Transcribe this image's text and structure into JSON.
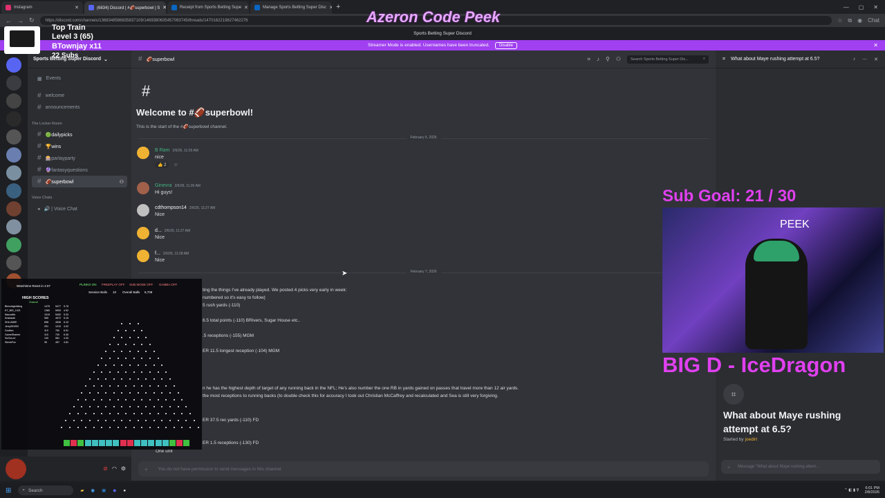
{
  "browser": {
    "tabs": [
      {
        "label": "Instagram",
        "color": "#e1306c",
        "active": false
      },
      {
        "label": "(6834) Discord | #🏈superbowl | S",
        "color": "#5865f2",
        "active": true
      },
      {
        "label": "Receipt from Sports Betting Supe",
        "color": "#0a66c2",
        "active": false
      },
      {
        "label": "Manage Sports Betting Super Disc",
        "color": "#0a66c2",
        "active": false
      }
    ],
    "url": "https://discord.com/channels/1368348586835837109/1469380635457093745/threads/1470162219827462276",
    "new_tab": "+",
    "chat_label": "Chat"
  },
  "overlay": {
    "brand": "Azeron Code Peek",
    "twitch_line1": "Top Train",
    "twitch_line2": "Level 3  (65)",
    "twitch_line3": "BTownjay x11",
    "twitch_line4": "22 Subs",
    "sub_goal": "Sub Goal:  21 / 30",
    "cam_label": "PEEK",
    "big_d": "BIG D -  IceDragon"
  },
  "discord": {
    "top_title": "Sports Betting Super Discord",
    "streamer_msg": "Streamer Mode is enabled. Usernames have been truncated.",
    "streamer_disable": "Disable",
    "server_name": "Sports Betting Super Discord",
    "events": "Events",
    "channels_top": [
      "welcome",
      "announcements"
    ],
    "cat_locker": "The Locker Room",
    "locker_channels": [
      {
        "label": "🟢dailypicks",
        "bold": true
      },
      {
        "label": "🏆wins",
        "bold": true
      },
      {
        "label": "🎰parlayparty",
        "bold": false
      },
      {
        "label": "🔮fantasyquestions",
        "bold": false
      },
      {
        "label": "🏈superbowl",
        "selected": true
      }
    ],
    "cat_voice": "Voice Chats",
    "voice_channel": "🔊 | Voice Chat",
    "channel_header": "🏈superbowl",
    "search_placeholder": "Search Sports Betting Super Dis...",
    "welcome_title": "Welcome to #🏈superbowl!",
    "welcome_sub": "This is the start of the #🏈superbowl channel.",
    "date1": "February 6, 2026",
    "date2": "February 7, 2026",
    "messages": [
      {
        "user": "B Ram",
        "time": "2/6/26, 11:26 AM",
        "text": "nice",
        "color": "#43b581",
        "avatar": "#f0b232",
        "reaction": "👍 2"
      },
      {
        "user": "Ginevra",
        "time": "2/6/26, 11:26 AM",
        "text": "Hi guys!",
        "color": "#43b581",
        "avatar": "#a0604a"
      },
      {
        "user": "cdthompson14",
        "time": "2/6/26, 11:27 AM",
        "text": "Nice",
        "color": "#f2f3f5",
        "avatar": "#c0c0c0"
      },
      {
        "user": "d...",
        "time": "2/6/26, 11:27 AM",
        "text": "Nice",
        "color": "#f2f3f5",
        "avatar": "#f0b232"
      },
      {
        "user": "f...",
        "time": "2/6/26, 11:28 AM",
        "text": "Nice",
        "color": "#f2f3f5",
        "avatar": "#f0b232"
      }
    ],
    "post_lines": [
      "ting the things I've already played. We posted 4 picks very early in week:",
      " numbered so it's easy to follow)",
      "5 rush yards (-110)",
      "6.5 total points (-110) BRivers, Sugar House etc..",
      ".5 receptions (-155) MGM",
      "ER 11.5 longest reception (-104) MGM",
      "n he has the highest depth of target of any running back in the NFL; He's also number the one RB in yards gained on passes that travel more than 12 air yards.",
      "the most receptions to running backs (to double check this for accuracy I took out Christian McCaffrey and recalculated and Sea is still very forgiving.",
      "ER 37.5 rec yards (-110) FD",
      "ER 1.5 receptions (-130) FD",
      "One unit"
    ],
    "composer_placeholder": "You do not have permission to send messages in this channel.",
    "thread_header": "What about Maye rushing attempt at 6.5?",
    "thread_title": "What about Maye rushing attempt at 6.5?",
    "started_by_prefix": "Started by",
    "started_by_user": "joedirt",
    "thread_composer": "Message \"What about Maye rushing attem..."
  },
  "plinko": {
    "watchtime": "Watchtime Reset in 4:07",
    "toggles": [
      "PLINKO ON",
      "FREEPLAY OFF",
      "SUB MODE OFF",
      "GAMBA OFF"
    ],
    "session_label": "Session Balls",
    "session_val": "10",
    "overall_label": "Overall Balls",
    "overall_val": "6,708",
    "high_scores": "HIGH SCORES",
    "channel_label": "Channel",
    "rows": [
      [
        "Blenzidgebiking",
        "1475",
        "9477",
        "5.78"
      ],
      [
        "KT_BIG_1021",
        "1380",
        "5900",
        "4.92"
      ],
      [
        "Macuzilla",
        "1015",
        "5400",
        "5.33"
      ],
      [
        "Kristianth",
        "965",
        "4972",
        "5.15"
      ],
      [
        "SHLUMEE",
        "898",
        "4535",
        "5.10"
      ],
      [
        "Jerry051992",
        "291",
        "1210",
        "4.02"
      ],
      [
        "Godbec",
        "119",
        "760",
        "6.91"
      ],
      [
        "GameShamer",
        "115",
        "730",
        "6.35"
      ],
      [
        "SoGoLoV",
        "130",
        "581",
        "4.30"
      ],
      [
        "StevieFox",
        "95",
        "457",
        "4.81"
      ]
    ]
  },
  "taskbar": {
    "search": "Search",
    "time": "6:01 PM",
    "date": "2/8/2026"
  }
}
